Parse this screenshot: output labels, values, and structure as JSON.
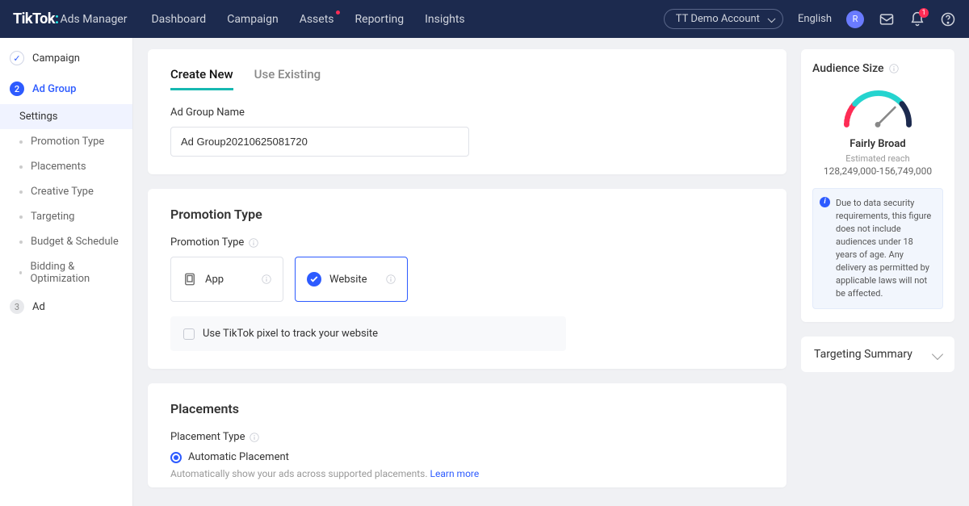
{
  "header": {
    "brand": "TikTok",
    "subbrand": "Ads Manager",
    "nav": [
      "Dashboard",
      "Campaign",
      "Assets",
      "Reporting",
      "Insights"
    ],
    "account": "TT Demo Account",
    "lang": "English",
    "avatar_initial": "R",
    "notif_count": "1"
  },
  "sidebar": {
    "steps": [
      {
        "label": "Campaign",
        "state": "done"
      },
      {
        "label": "Ad Group",
        "state": "active",
        "num": "2"
      },
      {
        "label": "Ad",
        "state": "pending",
        "num": "3"
      }
    ],
    "subs": [
      "Settings",
      "Promotion Type",
      "Placements",
      "Creative Type",
      "Targeting",
      "Budget & Schedule",
      "Bidding & Optimization"
    ]
  },
  "create": {
    "tabs": [
      "Create New",
      "Use Existing"
    ],
    "name_label": "Ad Group Name",
    "name_value": "Ad Group20210625081720"
  },
  "promo": {
    "title": "Promotion Type",
    "field_label": "Promotion Type",
    "options": [
      {
        "label": "App"
      },
      {
        "label": "Website"
      }
    ],
    "pixel_label": "Use TikTok pixel to track your website"
  },
  "placements": {
    "title": "Placements",
    "field_label": "Placement Type",
    "auto_label": "Automatic Placement",
    "auto_hint": "Automatically show your ads across supported placements.",
    "learn_more": "Learn more"
  },
  "audience": {
    "title": "Audience Size",
    "label": "Fairly Broad",
    "sub": "Estimated reach",
    "range": "128,249,000-156,749,000",
    "notice": "Due to data security requirements, this figure does not include audiences under 18 years of age. Any delivery as permitted by applicable laws will not be affected."
  },
  "targeting_summary": "Targeting Summary"
}
